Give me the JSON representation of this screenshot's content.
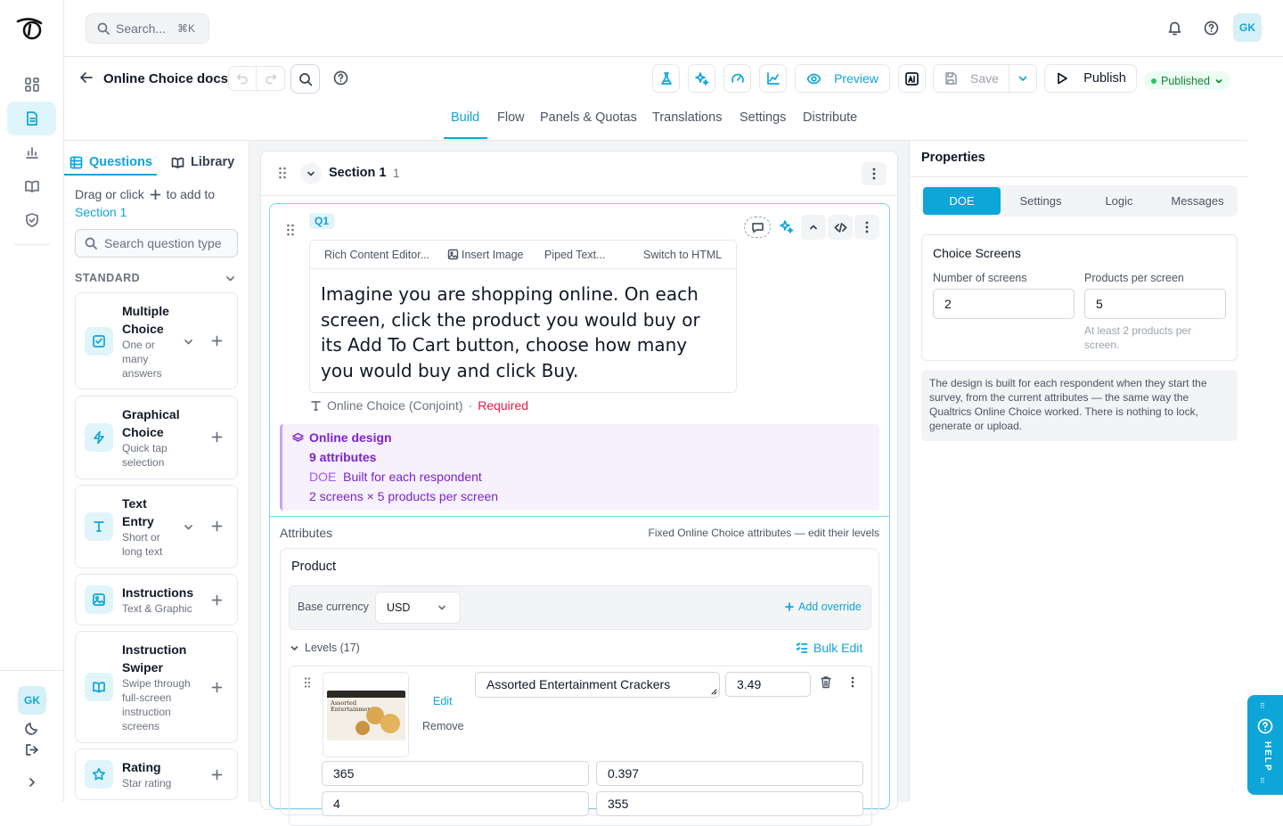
{
  "search": {
    "placeholder": "Search...",
    "shortcut": "⌘K"
  },
  "user": {
    "initials": "GK"
  },
  "survey": {
    "title": "Online Choice docs"
  },
  "toolbar": {
    "preview": "Preview",
    "save": "Save",
    "publish": "Publish",
    "status": "Published"
  },
  "tabs": [
    "Build",
    "Flow",
    "Panels & Quotas",
    "Translations",
    "Settings",
    "Distribute"
  ],
  "left": {
    "tab_questions": "Questions",
    "tab_library": "Library",
    "hint_prefix": "Drag or click",
    "hint_suffix": "to add to",
    "hint_target": "Section 1",
    "search_placeholder": "Search question type",
    "group": "STANDARD",
    "items": [
      {
        "title": "Multiple Choice",
        "sub": "One or many answers",
        "icon": "checkbox-icon"
      },
      {
        "title": "Graphical Choice",
        "sub": "Quick tap selection",
        "icon": "bolt-icon"
      },
      {
        "title": "Text Entry",
        "sub": "Short or long text",
        "icon": "text-icon"
      },
      {
        "title": "Instructions",
        "sub": "Text & Graphic",
        "icon": "image-icon"
      },
      {
        "title": "Instruction Swiper",
        "sub": "Swipe through full-screen instruction screens",
        "icon": "book-icon"
      },
      {
        "title": "Rating",
        "sub": "Star rating",
        "icon": "star-icon"
      }
    ]
  },
  "section": {
    "name": "Section 1",
    "count": "1"
  },
  "question": {
    "id": "Q1",
    "editor_tools": [
      "Rich Content Editor...",
      "Insert Image",
      "Piped Text...",
      "Switch to HTML"
    ],
    "text": "Imagine you are shopping online. On each screen, click the product you would buy or its Add To Cart button, choose how many you would buy and click Buy.",
    "type": "Online Choice (Conjoint)",
    "separator": "·",
    "required": "Required",
    "design": {
      "title": "Online design",
      "attributes": "9 attributes",
      "doe_label": "DOE",
      "doe_text": "Built for each respondent",
      "screens": "2 screens × 5 products per screen"
    },
    "attributes_label": "Attributes",
    "attributes_note": "Fixed Online Choice attributes — edit their levels",
    "product": {
      "title": "Product",
      "currency_label": "Base currency",
      "currency": "USD",
      "add_override": "Add override",
      "levels": "Levels (17)",
      "bulk_edit": "Bulk Edit",
      "level": {
        "name": "Assorted Entertainment Crackers",
        "price": "3.49",
        "edit": "Edit",
        "remove": "Remove",
        "field1": "365",
        "field2": "0.397",
        "field3": "4",
        "field4": "355",
        "image_text": "Assorted Entertainment"
      }
    }
  },
  "properties": {
    "title": "Properties",
    "tabs": [
      "DOE",
      "Settings",
      "Logic",
      "Messages"
    ],
    "box_title": "Choice Screens",
    "screens_label": "Number of screens",
    "screens_value": "2",
    "products_label": "Products per screen",
    "products_value": "5",
    "products_hint": "At least 2 products per screen.",
    "note": "The design is built for each respondent when they start the survey, from the current attributes — the same way the Qualtrics Online Choice worked. There is nothing to lock, generate or upload."
  },
  "help": {
    "label": "HELP"
  },
  "colors": {
    "accent": "#0ea5d9",
    "purple": "#7e22ce",
    "required": "#e11d48",
    "published": "#16a34a"
  }
}
